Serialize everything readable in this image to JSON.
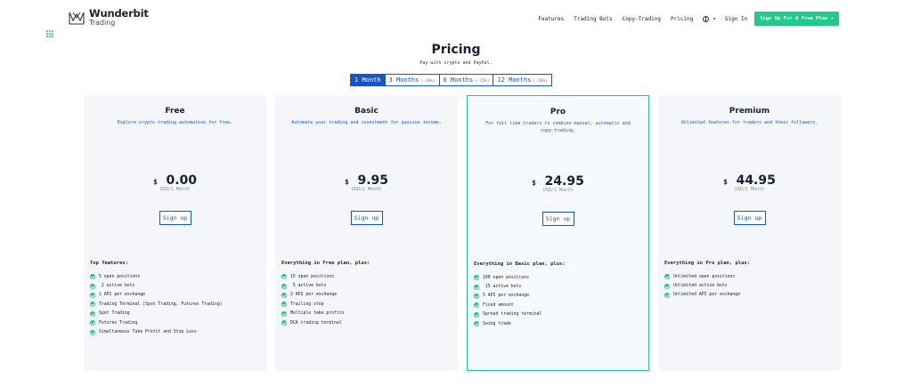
{
  "header": {
    "logo_name": "Wunderbit",
    "logo_sub": "Trading",
    "nav": [
      "Features",
      "Trading Bots",
      "Copy-Trading",
      "Pricing"
    ],
    "language_caret": "▾",
    "signin": "Sign In",
    "cta": "Sign Up For A Free Plan →"
  },
  "page": {
    "title": "Pricing",
    "subtitle": "Pay with crypto and PayPal."
  },
  "periods": [
    {
      "label": "1 Month",
      "discount": "",
      "active": true
    },
    {
      "label": "3 Months",
      "discount": "(-10%)",
      "active": false
    },
    {
      "label": "6 Months",
      "discount": "(-15%)",
      "active": false
    },
    {
      "label": "12 Months",
      "discount": "(-20%)",
      "active": false
    }
  ],
  "plans": [
    {
      "name": "Free",
      "description": "Explore crypto trading automation for free.",
      "currency": "$",
      "price": "0.00",
      "period": "USD/1 Month",
      "button": "Sign up",
      "features_heading": "Top features:",
      "features": [
        "5 open positions",
        " 2 active bots",
        "1 API per exchange",
        "Trading Terminal (Spot Trading, Futures Trading)",
        "Spot Trading",
        "Futures Trading",
        "Simultaneous Take Profit and Stop Loss"
      ]
    },
    {
      "name": "Basic",
      "description": "Automate your trading and investment for passive income.",
      "currency": "$",
      "price": "9.95",
      "period": "USD/1 Month",
      "button": "Sign up",
      "features_heading": "Everything in Free plan, plus:",
      "features": [
        "15 open positions",
        " 5 active bots",
        "2 API per exchange",
        "Trailing stop",
        "Multiple take profits",
        "DCA trading terminal"
      ]
    },
    {
      "name": "Pro",
      "description": "For full time traders to combine manual, automatic and copy-trading.",
      "currency": "$",
      "price": "24.95",
      "period": "USD/1 Month",
      "button": "Sign up",
      "features_heading": "Everything in Basic plan, plus:",
      "features": [
        "100 open positions",
        " 15 active bots",
        "5 API per exchange",
        "Fixed amount",
        "Spread trading terminal",
        "Swing trade"
      ]
    },
    {
      "name": "Premium",
      "description": "Unlimited features for traders and their followers.",
      "currency": "$",
      "price": "44.95",
      "period": "USD/1 Month",
      "button": "Sign up",
      "features_heading": "Everything in Pro plan, plus:",
      "features": [
        "Unlimited open positions",
        "Unlimited active bots",
        "Unlimited API per exchange"
      ]
    }
  ],
  "colors": {
    "accent_blue": "#1656c8",
    "accent_green": "#21c98a",
    "discount_red": "#e0534b",
    "card_bg": "#f4f6f9"
  },
  "icons": [
    "logo-icon",
    "dots-icon",
    "globe-icon",
    "check-icon"
  ]
}
